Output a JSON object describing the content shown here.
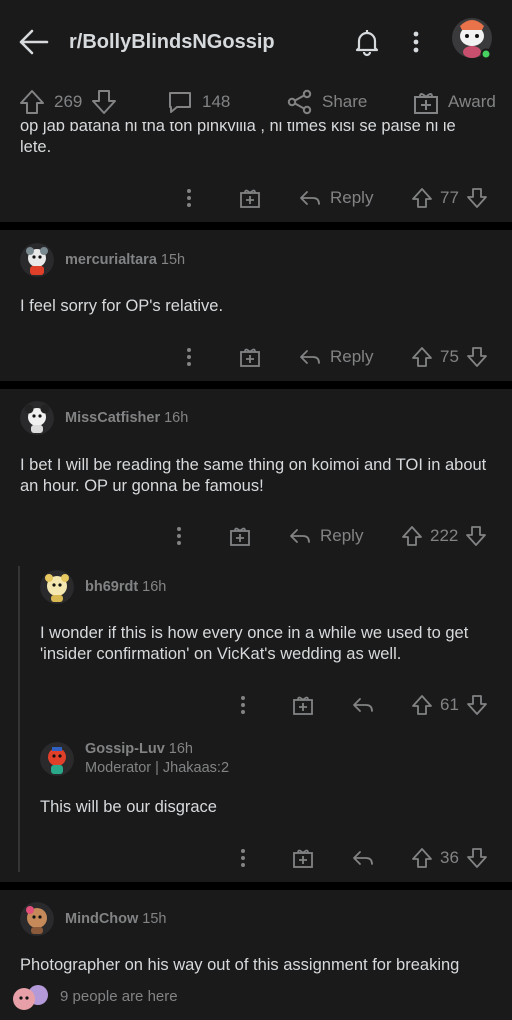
{
  "header": {
    "subreddit": "r/BollyBlindsNGossip"
  },
  "post_actions": {
    "score": "269",
    "comments": "148",
    "share_label": "Share",
    "award_label": "Award"
  },
  "comments": [
    {
      "text": "op jab batana hi tha ton pinkvilla , hi times kisi se paise hi le lete.",
      "reply_label": "Reply",
      "score": "77"
    },
    {
      "user": "mercurialtara",
      "age": "15h",
      "text": "I feel sorry for OP's relative.",
      "reply_label": "Reply",
      "score": "75"
    },
    {
      "user": "MissCatfisher",
      "age": "16h",
      "text": "I bet I will be reading the same thing on koimoi and TOI in about an hour. OP ur gonna be famous!",
      "reply_label": "Reply",
      "score": "222"
    },
    {
      "user": "bh69rdt",
      "age": "16h",
      "text": "I wonder if this is how every once in a while we used to get 'insider confirmation' on VicKat's wedding as well.",
      "score": "61"
    },
    {
      "user": "Gossip-Luv",
      "age": "16h",
      "flair": "Moderator | Jhakaas:2",
      "text": "This will be our disgrace",
      "score": "36"
    },
    {
      "user": "MindChow",
      "age": "15h",
      "text": "Photographer on his way out of this assignment for breaking"
    }
  ],
  "footer": {
    "presence": "9 people are here"
  },
  "colors": {
    "background": "#1a1a1b",
    "separator": "#000000",
    "text": "#d7dadc",
    "muted": "#818384",
    "online_dot": "#46d160"
  }
}
